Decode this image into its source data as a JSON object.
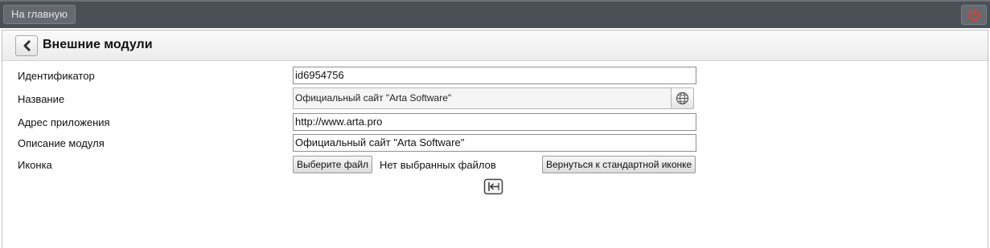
{
  "topbar": {
    "home_label": "На главную",
    "power_icon": "power-icon",
    "power_color": "#e0402f"
  },
  "header": {
    "title": "Внешние модули",
    "back_icon": "chevron-left-icon"
  },
  "form": {
    "id_label": "Идентификатор",
    "id_value": "id6954756",
    "name_label": "Название",
    "name_value": "Официальный сайт \"Arta Software\"",
    "name_icon": "globe-icon",
    "url_label": "Адрес приложения",
    "url_value": "http://www.arta.pro",
    "desc_label": "Описание модуля",
    "desc_value": "Официальный сайт \"Arta Software\"",
    "icon_label": "Иконка",
    "choose_file_label": "Выберите файл",
    "no_file_text": "Нет выбранных файлов",
    "reset_icon_label": "Вернуться к стандартной иконке",
    "module_icon": "insert-module-icon"
  }
}
